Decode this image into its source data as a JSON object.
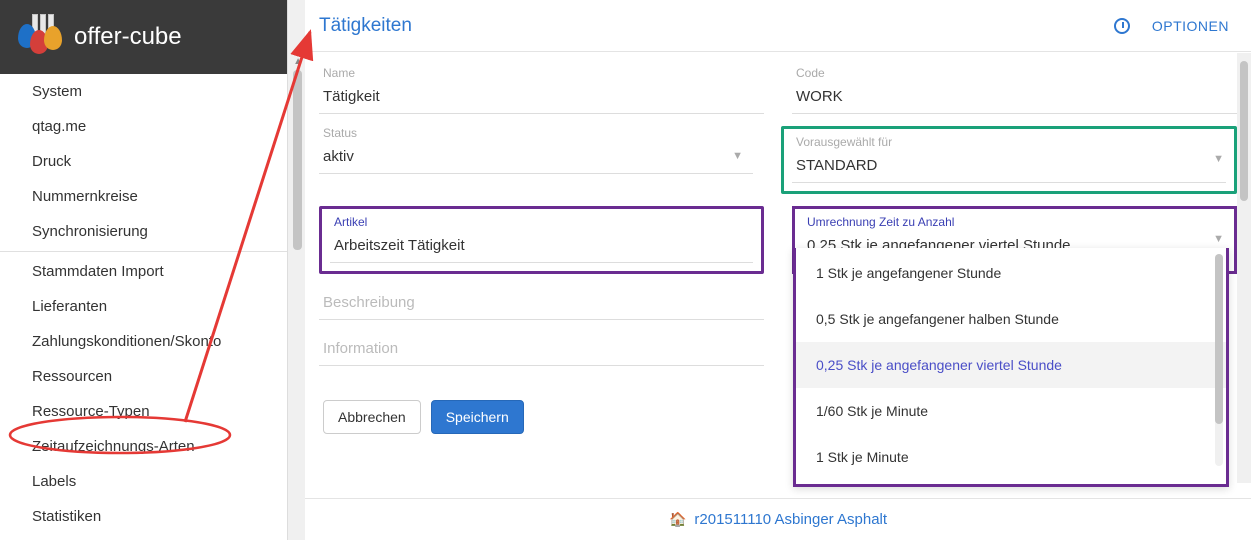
{
  "header": {
    "app_name": "offer-cube"
  },
  "sidebar": {
    "items_top": [
      "System",
      "qtag.me",
      "Druck",
      "Nummernkreise",
      "Synchronisierung"
    ],
    "items_mid": [
      "Stammdaten Import",
      "Lieferanten",
      "Zahlungskonditionen/Skonto",
      "Ressourcen",
      "Ressource-Typen",
      "Zeitaufzeichnungs-Arten",
      "Labels",
      "Statistiken"
    ]
  },
  "main": {
    "title": "Tätigkeiten",
    "options_label": "OPTIONEN"
  },
  "form": {
    "name_label": "Name",
    "name_value": "Tätigkeit",
    "code_label": "Code",
    "code_value": "WORK",
    "status_label": "Status",
    "status_value": "aktiv",
    "preselect_label": "Vorausgewählt für",
    "preselect_value": "STANDARD",
    "article_label": "Artikel",
    "article_value": "Arbeitszeit Tätigkeit",
    "conversion_label": "Umrechnung Zeit zu Anzahl",
    "conversion_value": "0,25 Stk je angefangener viertel Stunde",
    "description_placeholder": "Beschreibung",
    "information_placeholder": "Information"
  },
  "dropdown": {
    "options": [
      "1 Stk je angefangener Stunde",
      "0,5 Stk je angefangener halben Stunde",
      "0,25 Stk je angefangener viertel Stunde",
      "1/60 Stk je Minute",
      "1 Stk je Minute"
    ],
    "selected_index": 2
  },
  "buttons": {
    "cancel": "Abbrechen",
    "save": "Speichern"
  },
  "footer": {
    "text": "r201511110 Asbinger Asphalt"
  }
}
